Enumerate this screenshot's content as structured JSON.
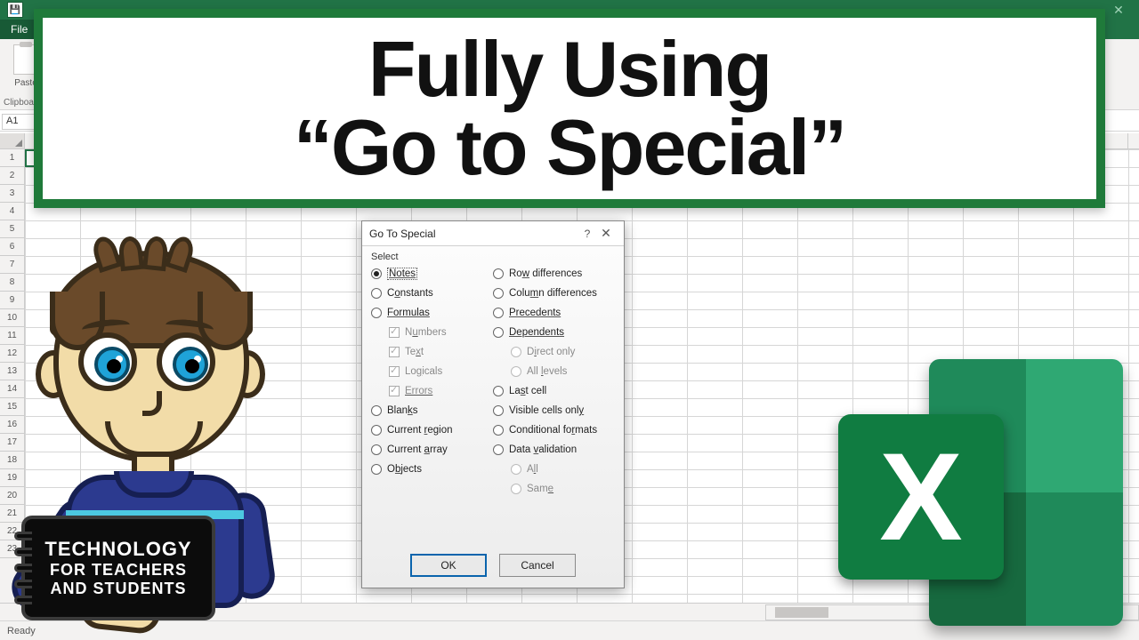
{
  "headline": {
    "line1": "Fully Using",
    "line2": "“Go to Special”"
  },
  "titlebar": {
    "menu_file": "File",
    "close_glyph": "✕",
    "save_glyph": "💾"
  },
  "ribbon": {
    "paste_label": "Paste",
    "group_clipboard": "Clipboa"
  },
  "namebox": {
    "value": "A1"
  },
  "sheet_tabs": {
    "add_glyph": "⊕"
  },
  "statusbar": {
    "ready": "Ready"
  },
  "row_headers": [
    1,
    2,
    3,
    4,
    5,
    6,
    7,
    8,
    9,
    10,
    11,
    12,
    13,
    14,
    15,
    16,
    17,
    18,
    19,
    20,
    21,
    22,
    23
  ],
  "dialog": {
    "title": "Go To Special",
    "help_glyph": "?",
    "close_glyph": "✕",
    "section": "Select",
    "left": {
      "notes": "Notes",
      "constants": "Constants",
      "formulas": "Formulas",
      "numbers": "Numbers",
      "text": "Text",
      "logicals": "Logicals",
      "errors": "Errors",
      "blanks": "Blanks",
      "current_region": "Current region",
      "current_array": "Current array",
      "objects": "Objects"
    },
    "right": {
      "row_diff": "Row differences",
      "col_diff": "Column differences",
      "precedents": "Precedents",
      "dependents": "Dependents",
      "direct_only": "Direct only",
      "all_levels": "All levels",
      "last_cell": "Last cell",
      "visible_cells": "Visible cells only",
      "cond_formats": "Conditional formats",
      "data_validation": "Data validation",
      "all": "All",
      "same": "Same"
    },
    "ok": "OK",
    "cancel": "Cancel",
    "selected": "notes"
  },
  "excel_icon": {
    "letter": "X"
  },
  "channel": {
    "l1": "TECHNOLOGY",
    "l2": "FOR TEACHERS",
    "l3": "AND STUDENTS"
  }
}
